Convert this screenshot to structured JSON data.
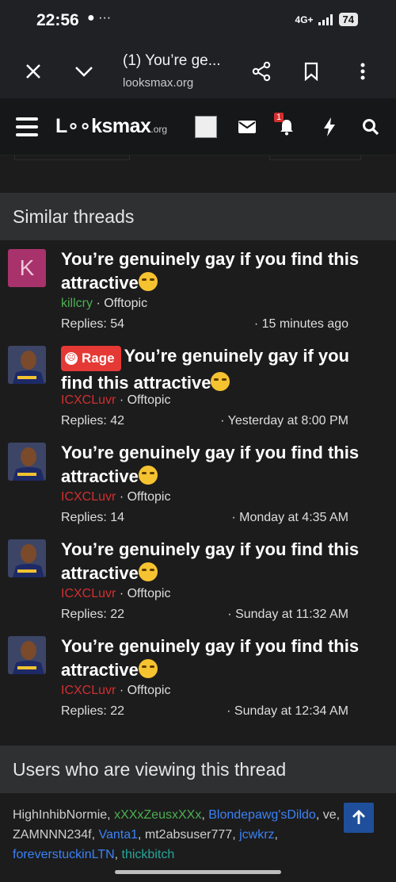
{
  "status_bar": {
    "time": "22:56",
    "icons": "● ···",
    "network": "4G+",
    "battery": "74"
  },
  "browser": {
    "tab_title": "(1) You’re ge...",
    "url": "looksmax.org"
  },
  "site_header": {
    "logo": "L∘∘ksmax",
    "logo_suffix": ".org",
    "notification_count": "1"
  },
  "similar": {
    "heading": "Similar threads",
    "threads": [
      {
        "prefix": "",
        "title": "You’re genuinely gay if you find this attractive",
        "author": "killcry",
        "author_color": "#4caf50",
        "forum": "Offtopic",
        "replies": "Replies: 54",
        "date": "15 minutes ago",
        "avatar": "K"
      },
      {
        "prefix": "Rage",
        "title": "You’re genuinely gay if you find this attractive",
        "author": "ICXCLuvr",
        "author_color": "#d32f2f",
        "forum": "Offtopic",
        "replies": "Replies: 42",
        "date": "Yesterday at 8:00 PM",
        "avatar": ""
      },
      {
        "prefix": "",
        "title": "You’re genuinely gay if you find this attractive",
        "author": "ICXCLuvr",
        "author_color": "#d32f2f",
        "forum": "Offtopic",
        "replies": "Replies: 14",
        "date": "Monday at 4:35 AM",
        "avatar": ""
      },
      {
        "prefix": "",
        "title": "You’re genuinely gay if you find this attractive",
        "author": "ICXCLuvr",
        "author_color": "#d32f2f",
        "forum": "Offtopic",
        "replies": "Replies: 22",
        "date": "Sunday at 11:32 AM",
        "avatar": ""
      },
      {
        "prefix": "",
        "title": "You’re genuinely gay if you find this attractive",
        "author": "ICXCLuvr",
        "author_color": "#d32f2f",
        "forum": "Offtopic",
        "replies": "Replies: 22",
        "date": "Sunday at 12:34 AM",
        "avatar": ""
      }
    ]
  },
  "viewers": {
    "heading": "Users who are viewing this thread",
    "users": [
      {
        "name": "HighInhibNormie",
        "color": "#cfcfcf"
      },
      {
        "name": "xXXxZeusxXXx",
        "color": "#4caf50"
      },
      {
        "name": "Blondepawg'sDildo",
        "color": "#3b82f6"
      },
      {
        "name": "ve",
        "color": "#cfcfcf"
      },
      {
        "name": "ZAMNNN234f",
        "color": "#cfcfcf"
      },
      {
        "name": "Vanta1",
        "color": "#3b82f6"
      },
      {
        "name": "mt2absuser777",
        "color": "#cfcfcf"
      },
      {
        "name": "jcwkrz",
        "color": "#3b82f6"
      },
      {
        "name": "foreverstuckinLTN",
        "color": "#3b82f6"
      },
      {
        "name": "thickbitch",
        "color": "#26a69a"
      }
    ]
  },
  "colors": {
    "accent_blue": "#1f4f9b",
    "prefix_red": "#e53935"
  }
}
